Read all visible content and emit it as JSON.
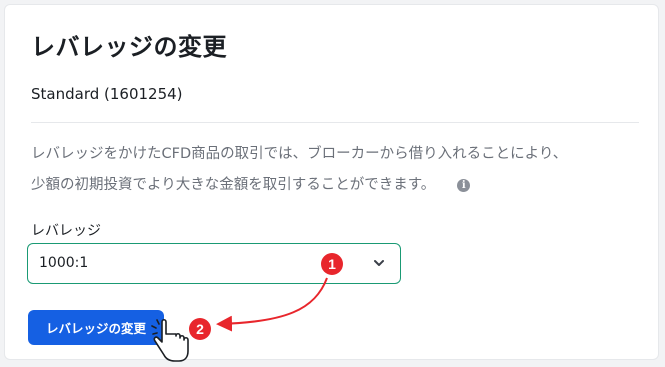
{
  "page": {
    "title": "レバレッジの変更",
    "account": "Standard (1601254)",
    "description_lines": [
      "レバレッジをかけたCFD商品の取引では、ブローカーから借り入れることにより、",
      "少額の初期投資でより大きな金額を取引することができます。"
    ],
    "info_icon": "info-circle-icon",
    "leverage_label": "レバレッジ",
    "leverage_value": "1000:1",
    "submit_label": "レバレッジの変更"
  },
  "annotations": {
    "step1": "1",
    "step2": "2"
  },
  "colors": {
    "primary": "#1560e3",
    "select_border": "#1a9a74",
    "annotation_red": "#e8262c"
  }
}
